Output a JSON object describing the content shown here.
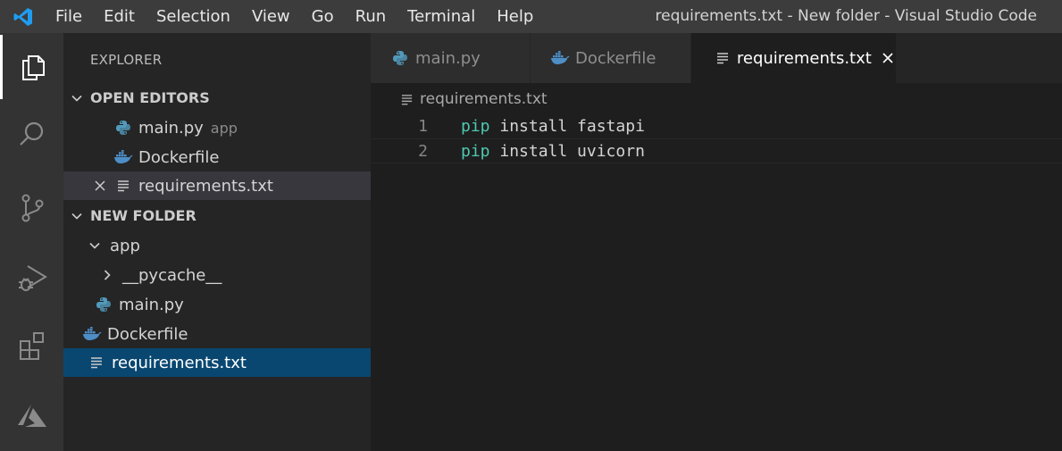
{
  "menu": [
    "File",
    "Edit",
    "Selection",
    "View",
    "Go",
    "Run",
    "Terminal",
    "Help"
  ],
  "window_title": "requirements.txt - New folder - Visual Studio Code",
  "activity_bar": {
    "items": [
      {
        "name": "explorer",
        "icon": "files-icon",
        "active": true
      },
      {
        "name": "search",
        "icon": "search-icon"
      },
      {
        "name": "source-control",
        "icon": "source-control-icon"
      },
      {
        "name": "run-debug",
        "icon": "run-debug-icon"
      },
      {
        "name": "extensions",
        "icon": "extensions-icon"
      },
      {
        "name": "azure",
        "icon": "azure-icon"
      }
    ]
  },
  "sidebar": {
    "title": "EXPLORER",
    "open_editors": {
      "header": "OPEN EDITORS",
      "items": [
        {
          "label": "main.py",
          "sub": "app",
          "icon": "python-icon"
        },
        {
          "label": "Dockerfile",
          "icon": "docker-icon"
        },
        {
          "label": "requirements.txt",
          "icon": "text-file-icon",
          "close": "×"
        }
      ]
    },
    "folder": {
      "header": "NEW FOLDER",
      "items": [
        {
          "label": "app",
          "type": "folder-open"
        },
        {
          "label": "__pycache__",
          "type": "folder-closed"
        },
        {
          "label": "main.py",
          "icon": "python-icon"
        },
        {
          "label": "Dockerfile",
          "icon": "docker-icon"
        },
        {
          "label": "requirements.txt",
          "icon": "text-file-icon"
        }
      ]
    }
  },
  "tabs": [
    {
      "label": "main.py",
      "icon": "python-icon"
    },
    {
      "label": "Dockerfile",
      "icon": "docker-icon"
    },
    {
      "label": "requirements.txt",
      "icon": "text-file-icon",
      "active": true
    }
  ],
  "breadcrumb": "requirements.txt",
  "editor": {
    "lines": [
      {
        "no": "1",
        "keyword": "pip",
        "rest": " install fastapi"
      },
      {
        "no": "2",
        "keyword": "pip",
        "rest": " install uvicorn"
      }
    ]
  },
  "colors": {
    "accent_blue": "#1f9cf0",
    "python_blue": "#519aba",
    "docker_blue": "#4d8ec6",
    "keyword": "#4ec9b0",
    "selection": "#094771"
  }
}
